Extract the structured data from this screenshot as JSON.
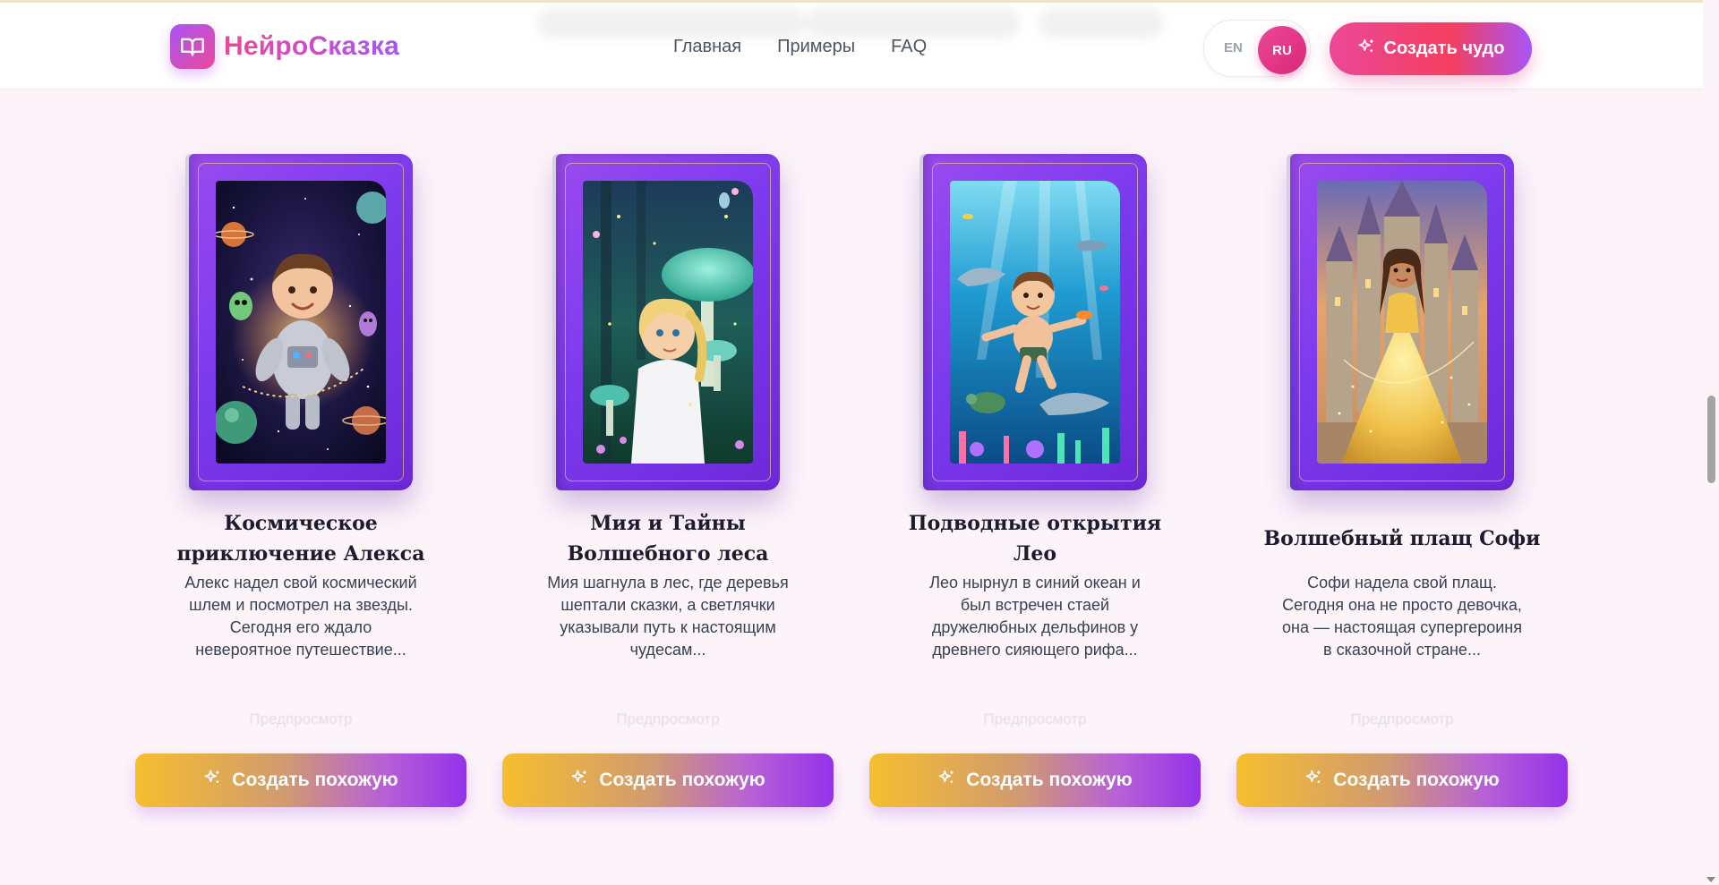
{
  "brand": {
    "name": "НейроСказка",
    "logo_icon": "book-open-icon"
  },
  "nav": {
    "items": [
      {
        "label": "Главная"
      },
      {
        "label": "Примеры"
      },
      {
        "label": "FAQ"
      }
    ]
  },
  "language": {
    "en": "EN",
    "ru": "RU",
    "active": "RU"
  },
  "header_cta": {
    "label": "Создать чудо",
    "icon": "sparkles-icon"
  },
  "colors": {
    "accent_pink": "#ec4899",
    "accent_purple": "#a855f7",
    "book_purple": "#7c3aed",
    "button_gold": "#f6be2e",
    "page_bg": "#fdf4fa"
  },
  "cards": [
    {
      "title": "Космическое приключение Алекса",
      "text": "Алекс надел свой космический шлем и посмотрел на звезды. Сегодня его ждало невероятное путешествие...",
      "preview_label": "Предпросмотр",
      "button_label": "Создать похожую",
      "theme": "space"
    },
    {
      "title": "Мия и Тайны Волшебного леса",
      "text": "Мия шагнула в лес, где деревья шептали сказки, а светлячки указывали путь к настоящим чудесам...",
      "preview_label": "Предпросмотр",
      "button_label": "Создать похожую",
      "theme": "forest"
    },
    {
      "title": "Подводные открытия Лео",
      "text": "Лео нырнул в синий океан и был встречен стаей дружелюбных дельфинов у древнего сияющего рифа...",
      "preview_label": "Предпросмотр",
      "button_label": "Создать похожую",
      "theme": "ocean"
    },
    {
      "title": "Волшебный плащ Софи",
      "text": "Софи надела свой плащ. Сегодня она не просто девочка, она — настоящая супергероиня в сказочной стране...",
      "preview_label": "Предпросмотр",
      "button_label": "Создать похожую",
      "theme": "castle"
    }
  ]
}
